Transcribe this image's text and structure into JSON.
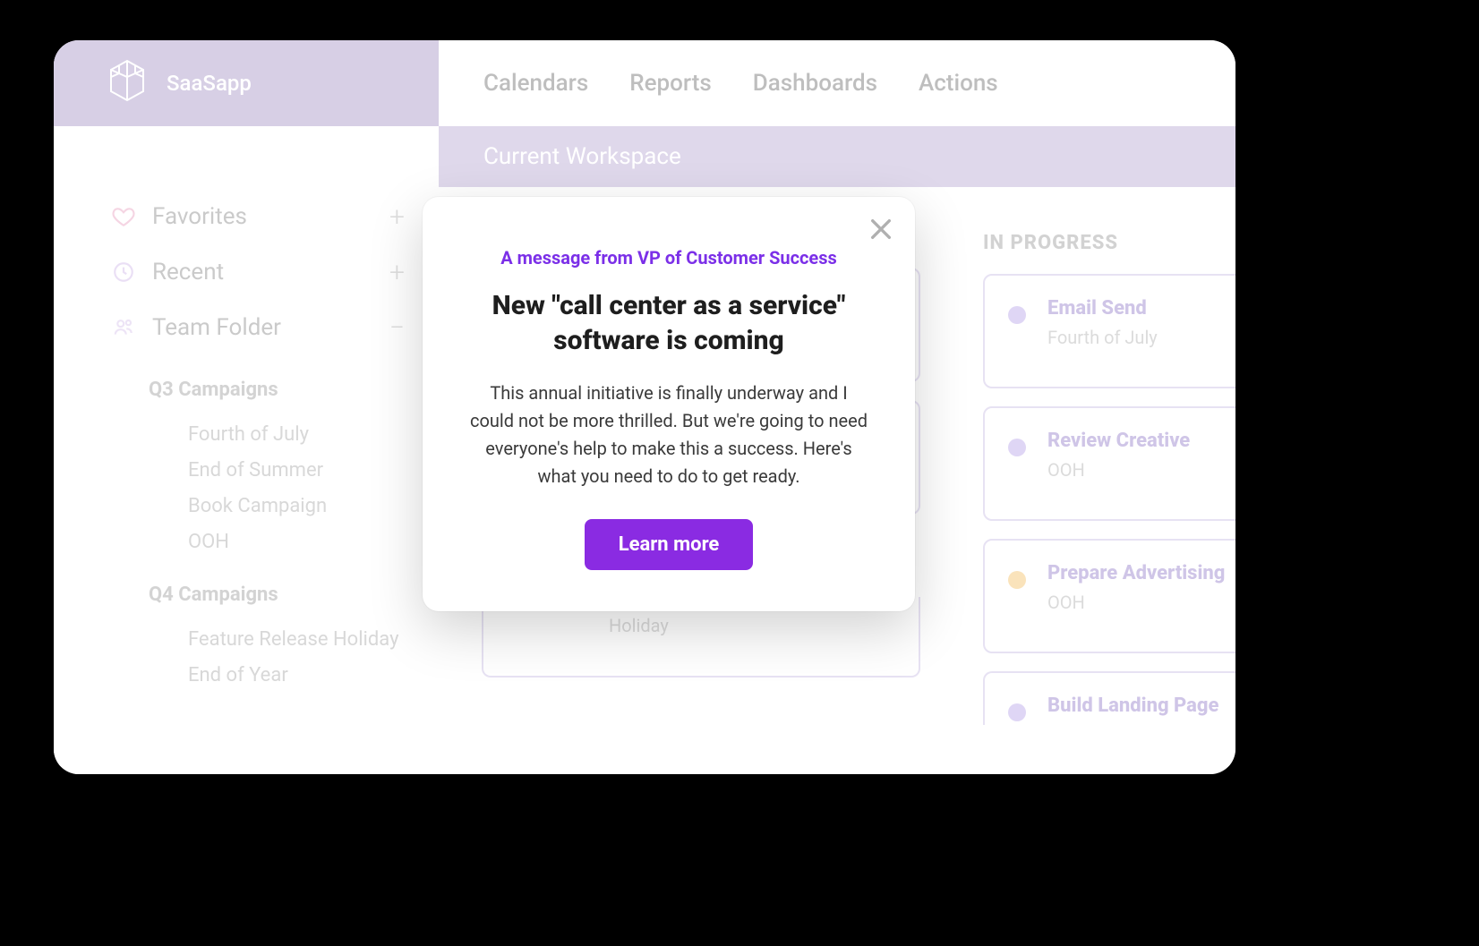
{
  "app": {
    "name": "SaaSapp"
  },
  "nav": {
    "items": [
      "Calendars",
      "Reports",
      "Dashboards",
      "Actions"
    ]
  },
  "workspace": {
    "label": "Current Workspace"
  },
  "sidebar": {
    "favorites": {
      "label": "Favorites",
      "action": "+"
    },
    "recent": {
      "label": "Recent",
      "action": "+"
    },
    "teamFolder": {
      "label": "Team Folder",
      "action": "−"
    },
    "folders": [
      {
        "name": "Q3 Campaigns",
        "items": [
          "Fourth of July",
          "End of Summer",
          "Book Campaign",
          "OOH"
        ]
      },
      {
        "name": "Q4 Campaigns",
        "items": [
          "Feature Release Holiday",
          "End of Year"
        ]
      }
    ]
  },
  "board": {
    "columns": [
      {
        "header": "",
        "cards": []
      },
      {
        "header": "IN PROGRESS",
        "cards": [
          {
            "title": "Email Send",
            "sub": "Fourth of July",
            "dot": "purple"
          },
          {
            "title": "Review Creative",
            "sub": "OOH",
            "dot": "purple"
          },
          {
            "title": "Prepare Advertising",
            "sub": "OOH",
            "dot": "orange"
          },
          {
            "title": "Build Landing Page",
            "sub": "",
            "dot": "purple"
          }
        ]
      }
    ],
    "holidayCardSub": "Holiday"
  },
  "modal": {
    "eyebrow": "A message from VP of Customer Success",
    "title": "New \"call center as a service\" software is coming",
    "body": "This annual initiative is finally underway and I could not be more thrilled. But we're going to need everyone's help to make this a success. Here's what you need to do to get ready.",
    "cta": "Learn more"
  }
}
